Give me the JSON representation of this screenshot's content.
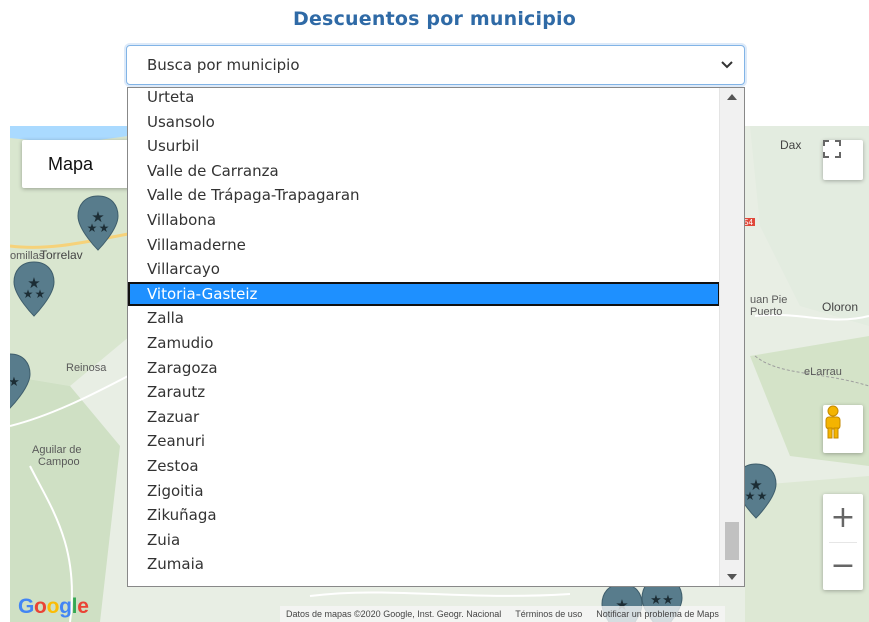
{
  "header": {
    "title": "Descuentos por municipio"
  },
  "search": {
    "placeholder": "Busca por municipio",
    "selected_value": "Vitoria-Gasteiz"
  },
  "dropdown": {
    "options": [
      "Urteta",
      "Usansolo",
      "Usurbil",
      "Valle de Carranza",
      "Valle de Trápaga-Trapagaran",
      "Villabona",
      "Villamaderne",
      "Villarcayo",
      "Vitoria-Gasteiz",
      "Zalla",
      "Zamudio",
      "Zaragoza",
      "Zarautz",
      "Zazuar",
      "Zeanuri",
      "Zestoa",
      "Zigoitia",
      "Zikuñaga",
      "Zuia",
      "Zumaia"
    ],
    "selected_index": 8,
    "scroll_position_fraction": 0.95
  },
  "map": {
    "type_button": "Mapa",
    "labels": {
      "dax": "Dax",
      "torrelavega": "Torrelav",
      "comillas": "omillas",
      "reinosa": "Reinosa",
      "aguilar": "Aguilar de",
      "campoo": "Campoo",
      "san_juan": "uan Pie",
      "puerto": "Puerto",
      "oloron": "Oloron",
      "larrau": "eLarrau",
      "route": "54"
    },
    "zoom_in": "+",
    "zoom_out": "−",
    "google": [
      "G",
      "o",
      "o",
      "g",
      "l",
      "e"
    ],
    "attribution": {
      "data": "Datos de mapas ©2020 Google, Inst. Geogr. Nacional",
      "terms": "Términos de uso",
      "report": "Notificar un problema de Maps"
    }
  },
  "colors": {
    "title": "#2f6aa6",
    "selected_bg": "#1e90ff",
    "select_border": "#82b4e6",
    "marker": "#587c8c"
  },
  "icons": {
    "chevron": "chevron-down-icon",
    "fullscreen": "fullscreen-icon",
    "pegman": "pegman-icon",
    "marker": "map-marker-icon"
  }
}
